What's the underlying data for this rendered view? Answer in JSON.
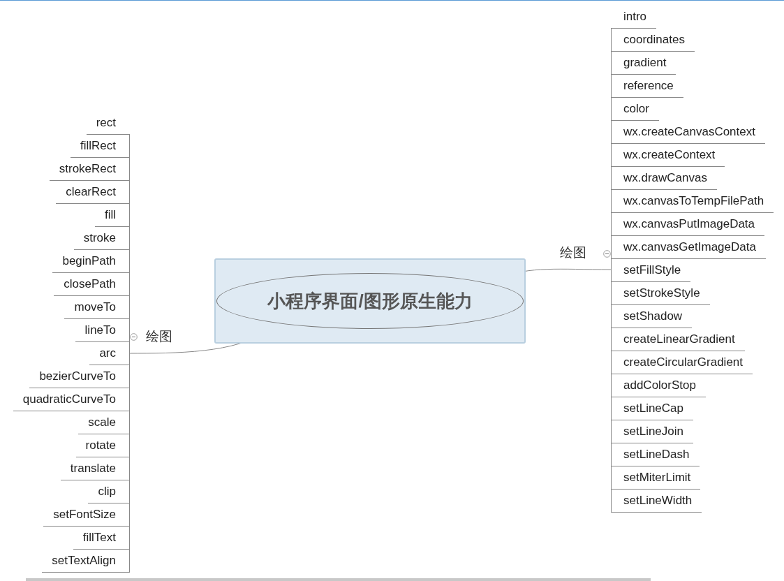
{
  "center": {
    "title": "小程序界面/图形原生能力"
  },
  "branches": [
    {
      "kind": "left",
      "label": "绘图",
      "expanded": true,
      "children": [
        {
          "label": "rect"
        },
        {
          "label": "fillRect"
        },
        {
          "label": "strokeRect"
        },
        {
          "label": "clearRect"
        },
        {
          "label": "fill"
        },
        {
          "label": "stroke"
        },
        {
          "label": "beginPath"
        },
        {
          "label": "closePath"
        },
        {
          "label": "moveTo"
        },
        {
          "label": "lineTo"
        },
        {
          "label": "arc"
        },
        {
          "label": "bezierCurveTo"
        },
        {
          "label": "quadraticCurveTo"
        },
        {
          "label": "scale"
        },
        {
          "label": "rotate"
        },
        {
          "label": "translate"
        },
        {
          "label": "clip"
        },
        {
          "label": "setFontSize"
        },
        {
          "label": "fillText"
        },
        {
          "label": "setTextAlign"
        }
      ]
    },
    {
      "kind": "right",
      "label": "绘图",
      "expanded": true,
      "children": [
        {
          "label": "intro"
        },
        {
          "label": "coordinates"
        },
        {
          "label": "gradient"
        },
        {
          "label": "reference"
        },
        {
          "label": "color"
        },
        {
          "label": "wx.createCanvasContext"
        },
        {
          "label": "wx.createContext"
        },
        {
          "label": "wx.drawCanvas"
        },
        {
          "label": "wx.canvasToTempFilePath"
        },
        {
          "label": "wx.canvasPutImageData"
        },
        {
          "label": "wx.canvasGetImageData"
        },
        {
          "label": "setFillStyle"
        },
        {
          "label": "setStrokeStyle"
        },
        {
          "label": "setShadow"
        },
        {
          "label": "createLinearGradient"
        },
        {
          "label": "createCircularGradient"
        },
        {
          "label": "addColorStop"
        },
        {
          "label": "setLineCap"
        },
        {
          "label": "setLineJoin"
        },
        {
          "label": "setLineDash"
        },
        {
          "label": "setMiterLimit"
        },
        {
          "label": "setLineWidth"
        }
      ]
    }
  ]
}
